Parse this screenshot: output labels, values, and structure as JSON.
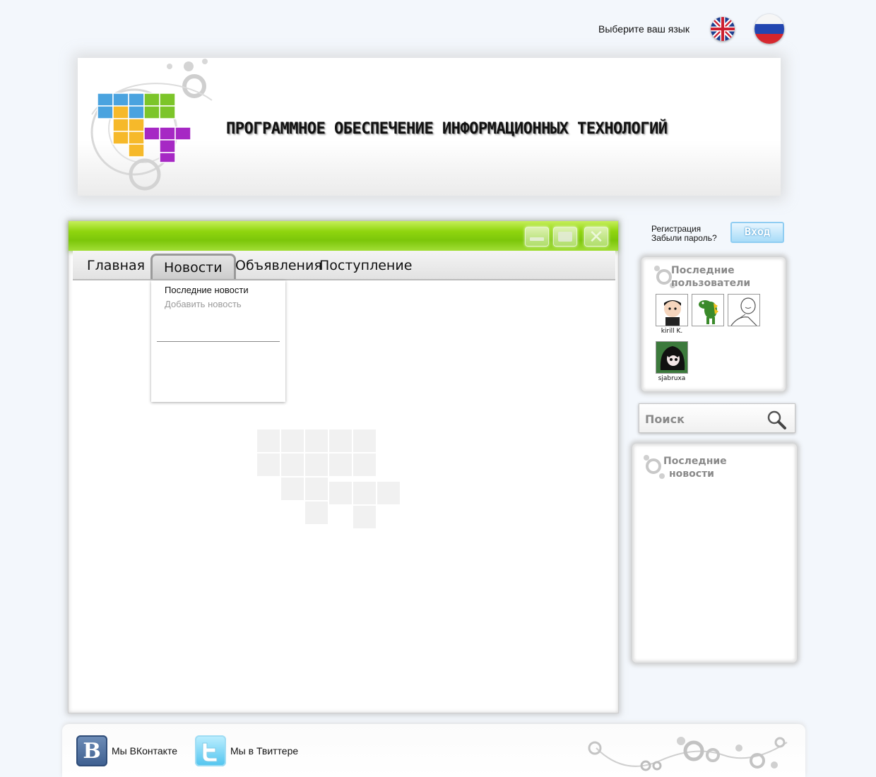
{
  "language": {
    "label": "Выберите ваш язык",
    "flags": [
      "english-flag",
      "russian-flag"
    ]
  },
  "header": {
    "site_title": "Программное Обеспечение Информационных Технологий",
    "logo_colors": [
      "#4aa3df",
      "#7cc52a",
      "#f6b92a",
      "#a628c4"
    ]
  },
  "window": {
    "accent_color": "#8fd50e",
    "controls": [
      "minimize-icon",
      "maximize-icon",
      "close-icon"
    ],
    "close_glyph": "✕"
  },
  "nav": {
    "items": [
      {
        "label": "Главная"
      },
      {
        "label": "Новости",
        "active": true
      },
      {
        "label": "Объявления"
      },
      {
        "label": "Поступление"
      }
    ]
  },
  "news_dropdown": {
    "items": [
      {
        "label": "Последние новости",
        "enabled": true
      },
      {
        "label": "Добавить новость",
        "enabled": false
      }
    ]
  },
  "auth": {
    "register": "Регистрация",
    "forgot": "Забыли пароль?",
    "login": "Вход",
    "login_color": "#8fcdf2"
  },
  "users_panel": {
    "title_line1": "Последние",
    "title_line2": "пользователи",
    "users": [
      {
        "name": "kirill K.",
        "avatar": "cartoon-boy-avatar"
      },
      {
        "name": "",
        "avatar": "green-dinosaur-avatar"
      },
      {
        "name": "",
        "avatar": "sketch-face-avatar"
      },
      {
        "name": "sjabruxa",
        "avatar": "dark-hair-girl-avatar"
      }
    ]
  },
  "search": {
    "placeholder": "Поиск",
    "icon": "search-icon"
  },
  "news_panel": {
    "title_line1": "Последние",
    "title_line2": "новости"
  },
  "footer": {
    "vk_label": "Мы ВКонтакте",
    "vk_icon_letter": "B",
    "twitter_label": "Мы в Твиттере",
    "vk_color": "#3d5e8f",
    "twitter_color": "#4fc4ef"
  }
}
